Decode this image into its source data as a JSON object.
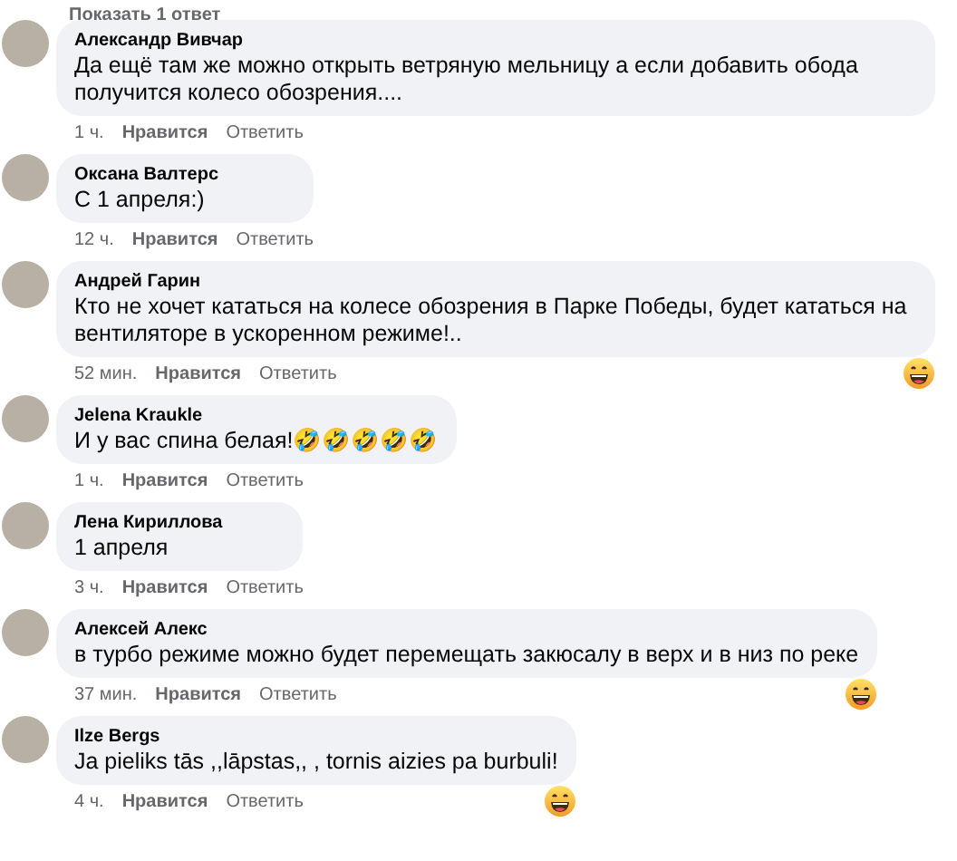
{
  "show_replies": "Показать 1 ответ",
  "comments": [
    {
      "author": "Александр Вивчар",
      "text": "Да ещё там же можно открыть ветряную мельницу а если добавить обода получится колесо обозрения....",
      "time": "1 ч.",
      "like": "Нравится",
      "reply": "Ответить",
      "reaction": false
    },
    {
      "author": "Оксана Валтерс",
      "text": "С 1 апреля:)",
      "time": "12 ч.",
      "like": "Нравится",
      "reply": "Ответить",
      "reaction": false
    },
    {
      "author": "Андрей Гарин",
      "text": "Кто не хочет кататься на колесе обозрения в Парке Победы, будет кататься на вентиляторе в ускоренном режиме!..",
      "time": "52 мин.",
      "like": "Нравится",
      "reply": "Ответить",
      "reaction": true
    },
    {
      "author": "Jelena Kraukle",
      "text": "И у вас спина белая!🤣🤣🤣🤣🤣",
      "time": "1 ч.",
      "like": "Нравится",
      "reply": "Ответить",
      "reaction": false
    },
    {
      "author": "Лена Кириллова",
      "text": "1 апреля",
      "time": "3 ч.",
      "like": "Нравится",
      "reply": "Ответить",
      "reaction": false
    },
    {
      "author": "Алексей Алекс",
      "text": "в турбо режиме можно будет перемещать закюсалу в верх и в низ по реке",
      "time": "37 мин.",
      "like": "Нравится",
      "reply": "Ответить",
      "reaction": true
    },
    {
      "author": "Ilze Bergs",
      "text": "Ja pieliks tās ,,lāpstas,, , tornis aizies pa burbuli!",
      "time": "4 ч.",
      "like": "Нравится",
      "reply": "Ответить",
      "reaction": true
    }
  ]
}
